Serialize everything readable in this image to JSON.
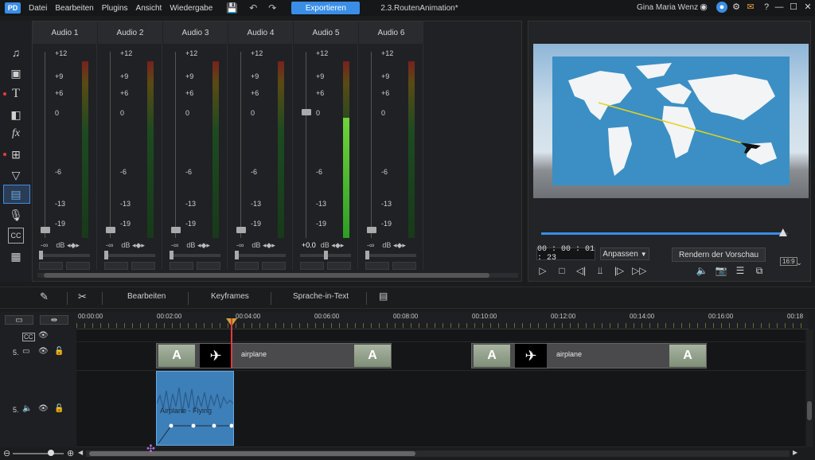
{
  "menu": {
    "items": [
      "Datei",
      "Bearbeiten",
      "Plugins",
      "Ansicht",
      "Wiedergabe"
    ],
    "export_label": "Exportieren",
    "project_title": "2.3.RoutenAnimation*",
    "user_name": "Gina Maria Wenz"
  },
  "mixer": {
    "channels": [
      {
        "name": "Audio 1",
        "level": 0,
        "db": "dB"
      },
      {
        "name": "Audio 2",
        "level": 0,
        "db": "dB"
      },
      {
        "name": "Audio 3",
        "level": 0,
        "db": "dB"
      },
      {
        "name": "Audio 4",
        "level": 0,
        "db": "dB"
      },
      {
        "name": "Audio 5",
        "level": 0.68,
        "db": "dB",
        "value": "+0.0"
      },
      {
        "name": "Audio 6",
        "level": 0,
        "db": "dB"
      }
    ],
    "ticks": [
      "+12",
      "+9",
      "+6",
      "0",
      "-6",
      "-13",
      "-19",
      "-∞"
    ]
  },
  "preview": {
    "timecode": "00 : 00 : 01 : 23",
    "fit_label": "Anpassen",
    "render_label": "Rendern der Vorschau",
    "aspect_label": "16:9",
    "progress": 0.98
  },
  "timeline_toolbar": {
    "edit_label": "Bearbeiten",
    "keyframes_label": "Keyframes",
    "speech_label": "Sprache-in-Text"
  },
  "timeline": {
    "ruler": [
      "00:00:00",
      "00:02:00",
      "00:04:00",
      "00:06:00",
      "00:08:00",
      "00:10:00",
      "00:12:00",
      "00:14:00",
      "00:16:00",
      "00:18"
    ],
    "video_track_number": "5.",
    "audio_track_number": "5.",
    "clips": [
      {
        "label": "airplane"
      },
      {
        "label": "airplane"
      }
    ],
    "audio_clip_label": "Airplane - Flying"
  },
  "colors": {
    "accent": "#3a8ee6",
    "playhead": "#e23b3b",
    "meter_green": "#4fbf2f"
  }
}
